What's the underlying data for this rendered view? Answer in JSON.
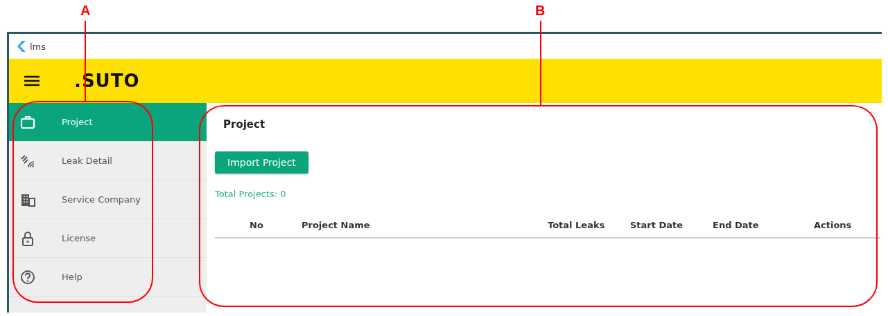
{
  "window": {
    "title": "lms"
  },
  "header": {
    "logo": ".SUTO"
  },
  "sidebar": {
    "items": [
      {
        "label": "Project",
        "kind": "briefcase",
        "selected": true
      },
      {
        "label": "Leak Detail",
        "kind": "leak",
        "selected": false
      },
      {
        "label": "Service Company",
        "kind": "building",
        "selected": false
      },
      {
        "label": "License",
        "kind": "lock",
        "selected": false
      },
      {
        "label": "Help",
        "kind": "help",
        "selected": false
      }
    ]
  },
  "main": {
    "title": "Project",
    "import_button": "Import Project",
    "total": "Total Projects: 0",
    "table": {
      "columns": [
        "No",
        "Project Name",
        "Total Leaks",
        "Start Date",
        "End Date",
        "Actions"
      ]
    }
  },
  "callouts": [
    {
      "label": "A"
    },
    {
      "label": "B"
    }
  ]
}
